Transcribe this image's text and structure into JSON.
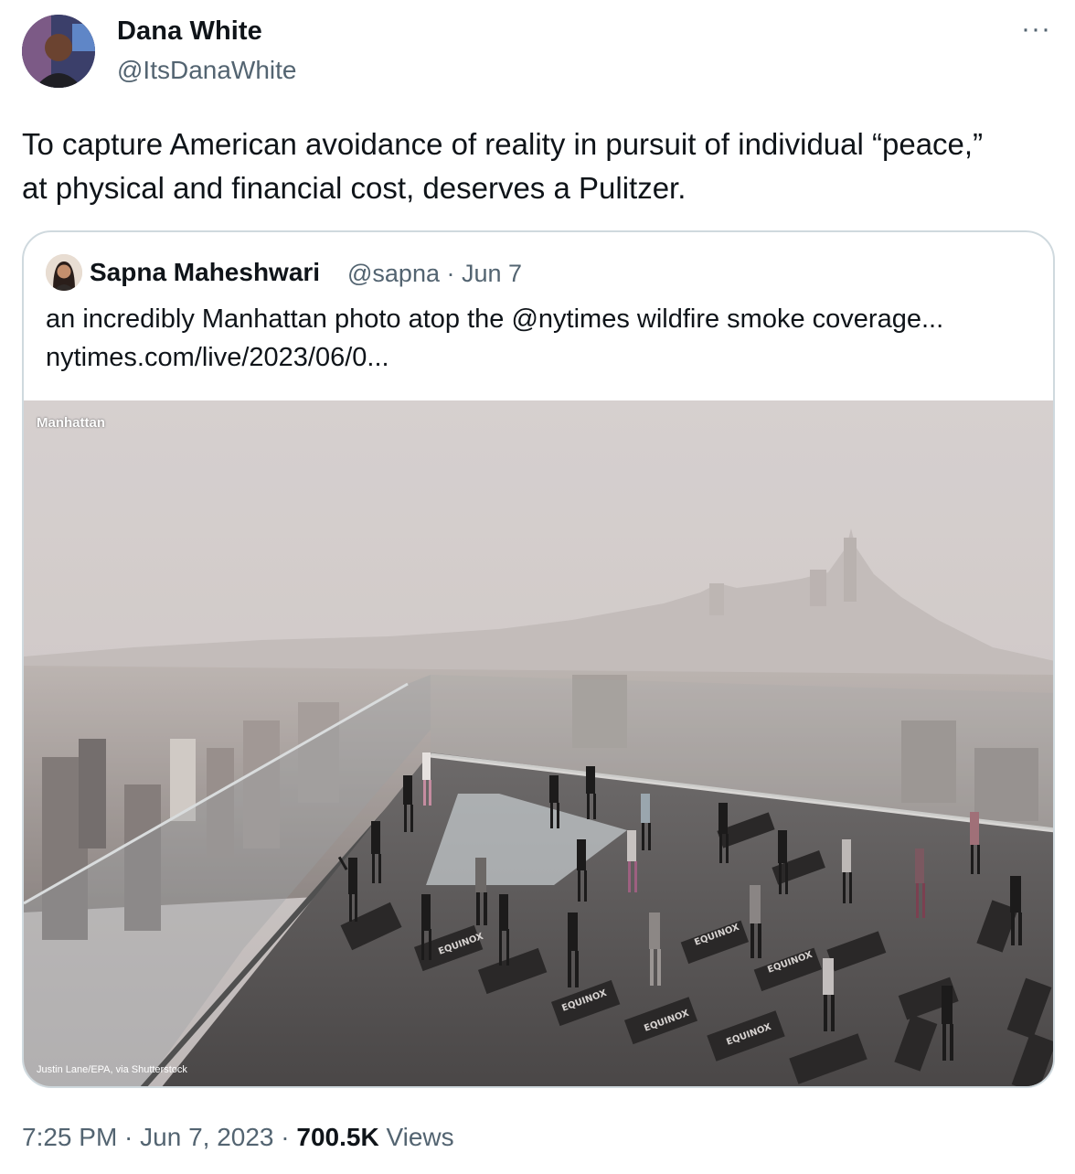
{
  "author": {
    "name": "Dana White",
    "handle": "@ItsDanaWhite"
  },
  "more_label": "···",
  "tweet": {
    "text_lines": [
      "To capture American avoidance of reality in pursuit of individual “peace,”",
      "at physical and financial cost, deserves a Pulitzer."
    ]
  },
  "quoted": {
    "name": "Sapna Maheshwari",
    "meta": "@sapna · Jun 7",
    "text_lines": [
      "an incredibly Manhattan photo atop the @nytimes wildfire smoke coverage...",
      "nytimes.com/live/2023/06/0..."
    ],
    "image": {
      "tag": "Manhattan",
      "credit": "Justin Lane/EPA, via Shutterstock",
      "mat_text": "EQUINOX"
    }
  },
  "footer": {
    "time": "7:25 PM · Jun 7, 2023 · ",
    "views_count": "700.5K",
    "views_label": " Views"
  },
  "colors": {
    "text": "#0f1419",
    "secondary": "#536471",
    "border": "#cfd9de"
  }
}
